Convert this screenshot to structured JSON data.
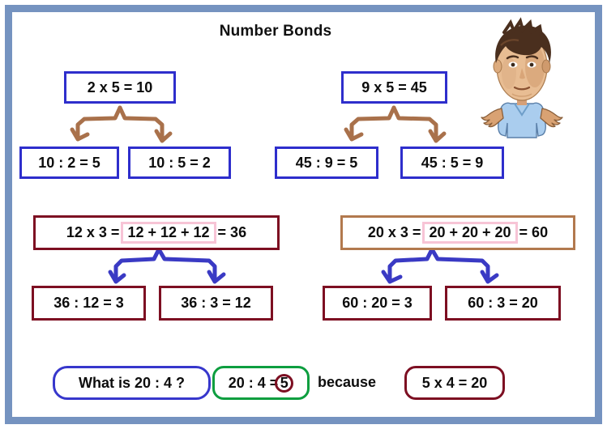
{
  "page": {
    "title": "Number Bonds",
    "frame_color": "#7593c0",
    "background": "#ffffff"
  },
  "colors": {
    "blue_border": "#2e2ecc",
    "dark_red_border": "#7d0f22",
    "brown_border": "#b2794e",
    "green_border": "#0d9e3f",
    "pink_inner_border": "#f7c4d6",
    "brown_arrow": "#a9714b",
    "blue_arrow": "#3a3ac4",
    "text": "#0d0d0d"
  },
  "groups": [
    {
      "id": "group-1",
      "parent": "2 x 5 = 10",
      "parent_border": "blue",
      "children": [
        "10 : 2 = 5",
        "10 : 5 = 2"
      ],
      "child_border": "blue",
      "arrow_color": "brown"
    },
    {
      "id": "group-2",
      "parent": "9 x 5 = 45",
      "parent_border": "blue",
      "children": [
        "45 : 9 = 5",
        "45 : 5 = 9"
      ],
      "child_border": "blue",
      "arrow_color": "brown"
    },
    {
      "id": "group-3",
      "parent_prefix": "12 x 3 =",
      "parent_inner": "12 + 12 + 12",
      "parent_suffix": "= 36",
      "parent_border": "dark-red",
      "children": [
        "36 : 12 = 3",
        "36 : 3 = 12"
      ],
      "child_border": "dark-red",
      "arrow_color": "blue"
    },
    {
      "id": "group-4",
      "parent_prefix": "20 x 3 =",
      "parent_inner": "20 + 20 + 20",
      "parent_suffix": "= 60",
      "parent_border": "brown",
      "children": [
        "60 : 20 = 3",
        "60 : 3 = 20"
      ],
      "child_border": "dark-red",
      "arrow_color": "blue"
    }
  ],
  "bottom": {
    "question": "What is 20 : 4 ?",
    "answer_prefix": "20 : 4 =",
    "answer_value": "5",
    "connector": "because",
    "justification": "5 x 4 = 20"
  },
  "avatar": {
    "name": "shrugging-boy-avatar",
    "shirt_color": "#aacdee",
    "hair_color": "#4a2f1e",
    "skin_color": "#e2b48c"
  }
}
